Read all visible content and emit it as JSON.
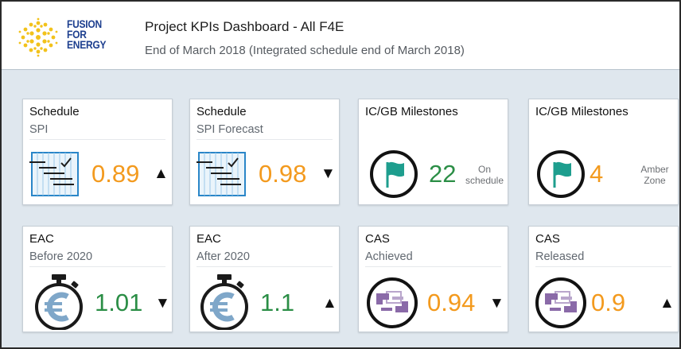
{
  "header": {
    "logo_lines": [
      "FUSION",
      "FOR",
      "ENERGY"
    ],
    "title": "Project KPIs Dashboard  - All F4E",
    "subtitle": "End of March 2018 (Integrated schedule end of March 2018)"
  },
  "colors": {
    "orange": "#f39a1e",
    "green": "#2b8e46",
    "icon_blue": "#2a86c8",
    "flag_teal": "#1e9e8e",
    "cas_purple": "#8a6aa8"
  },
  "tiles": [
    {
      "title": "Schedule",
      "subtitle": "SPI",
      "value": "0.89",
      "trend": "▲",
      "status": "orange",
      "icon": "schedule-chart-icon"
    },
    {
      "title": "Schedule",
      "subtitle": "SPI Forecast",
      "value": "0.98",
      "trend": "▼",
      "status": "orange",
      "icon": "schedule-chart-icon"
    },
    {
      "title": "IC/GB Milestones",
      "subtitle": "",
      "value": "22",
      "note_1": "On",
      "note_2": "schedule",
      "status": "green",
      "icon": "flag-icon"
    },
    {
      "title": "IC/GB Milestones",
      "subtitle": "",
      "value": "4",
      "note_1": "Amber",
      "note_2": "Zone",
      "status": "orange",
      "icon": "flag-icon"
    },
    {
      "title": "EAC",
      "subtitle": "Before 2020",
      "value": "1.01",
      "trend": "▼",
      "status": "green",
      "icon": "euro-stopwatch-icon"
    },
    {
      "title": "EAC",
      "subtitle": "After 2020",
      "value": "1.1",
      "trend": "▲",
      "status": "green",
      "icon": "euro-stopwatch-icon"
    },
    {
      "title": "CAS",
      "subtitle": "Achieved",
      "value": "0.94",
      "trend": "▼",
      "status": "orange",
      "icon": "handshake-icon"
    },
    {
      "title": "CAS",
      "subtitle": "Released",
      "value": "0.9",
      "trend": "▲",
      "status": "orange",
      "icon": "handshake-icon"
    }
  ]
}
